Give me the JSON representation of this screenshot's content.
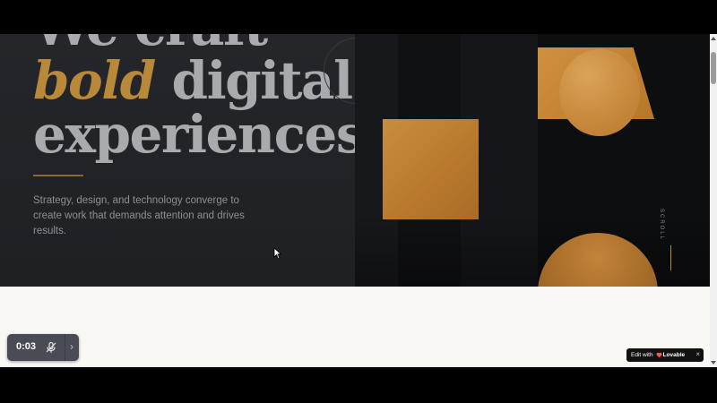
{
  "hero": {
    "headline_line1": "We craft",
    "headline_accent": "bold",
    "headline_line2_rest": " digital",
    "headline_line3": "experiences",
    "subtext": "Strategy, design, and technology converge to create work that demands attention and drives results.",
    "scroll_label": "SCROLL"
  },
  "video_widget": {
    "time": "0:03",
    "mic_icon": "mic-muted-icon",
    "chevron": "›"
  },
  "badge": {
    "edit_label": "Edit with",
    "brand": "Lovable",
    "close": "×"
  },
  "colors": {
    "accent_gold": "#b9893a",
    "hero_bg": "#1f2125",
    "headline": "#a9aaad",
    "page_bg": "#faf8f5"
  }
}
